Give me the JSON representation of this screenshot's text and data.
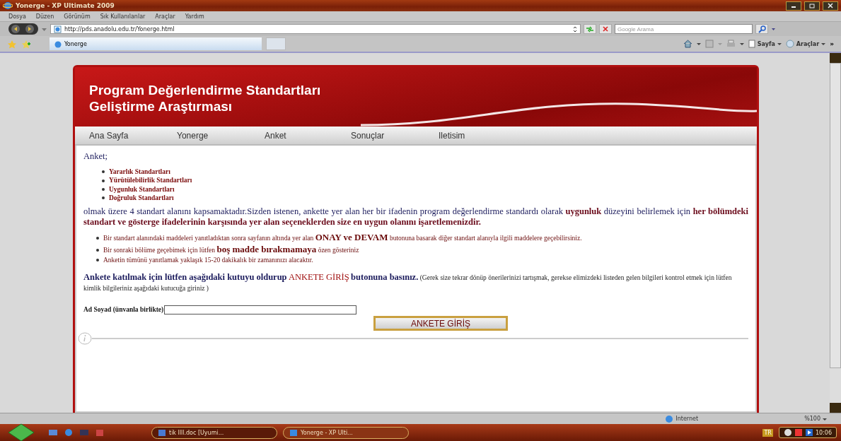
{
  "window": {
    "title": "Yonerge - XP Ultimate 2009"
  },
  "menu": [
    "Dosya",
    "Düzen",
    "Görünüm",
    "Sık Kullanılanlar",
    "Araçlar",
    "Yardım"
  ],
  "address": {
    "value": "http://pds.anadolu.edu.tr/Yonerge.html"
  },
  "search": {
    "placeholder": "Google Arama"
  },
  "tabs": [
    {
      "label": "Yonerge",
      "selected": true
    }
  ],
  "command_bar": {
    "page": "Sayfa",
    "tools": "Araçlar",
    "more": "»"
  },
  "site": {
    "title_lines": [
      "Program Değerlendirme Standartları",
      "Geliştirme Araştırması"
    ],
    "nav": [
      "Ana Sayfa",
      "Yonerge",
      "Anket",
      "Sonuçlar",
      "Iletisim"
    ],
    "intro": "Anket;",
    "standards": [
      "Yararlık Standartları",
      "Yürütülebilirlik Standartları",
      "Uygunluk Standartları",
      "Doğruluk Standartları"
    ],
    "paragraph": "olmak üzere 4 standart alanını kapsamaktadır.Sizden istenen, ankette yer alan her bir ifadenin program değerlendirme standardı olarak **uygunluk** düzeyini belirlemek için **her bölümdeki standart ve gösterge ifadelerinin karşısında yer alan seçeneklerden size en uygun olanını işaretlemenizdir.**",
    "notes": [
      "Bir standart alanındaki maddeleri yanıtladıktan sonra sayfanın altında yer alan **ONAY ve DEVAM** butonuna basarak diğer standart alanıyla ilgili maddelere geçebilirsiniz.",
      "Bir sonraki bölüme geçebimek için lütfen **boş madde bırakmamaya** özen gösteriniz",
      "Anketin tümünü yanıtlamak yaklaşık 15-20 dakikalık bir zamanınızı alacaktır."
    ],
    "instruction_lead": "Ankete katılmak için lütfen aşağıdaki kutuyu oldurup",
    "instruction_button_ref": "ANKETE GİRİŞ",
    "instruction_tail": "butonuna basınız.",
    "instruction_note": "(Gerek size tekrar dönüp önerilerinizi tartışmak, gerekse elimizdeki listeden gelen bilgileri kontrol etmek için lütfen kimlik bilgileriniz aşağıdaki kutucuğa giriniz )",
    "name_label": "Ad Soyad (ünvanla birlikte)",
    "submit": "ANKETE GİRİŞ"
  },
  "status_bar": {
    "zone": "Internet",
    "zoom": "%100"
  },
  "taskbar": {
    "tasks": [
      {
        "label": "tik llll.doc [Uyumi...",
        "selected": false
      },
      {
        "label": "Yonerge - XP Ulti...",
        "selected": true
      }
    ],
    "lang": "TR",
    "clock": "10:06"
  }
}
